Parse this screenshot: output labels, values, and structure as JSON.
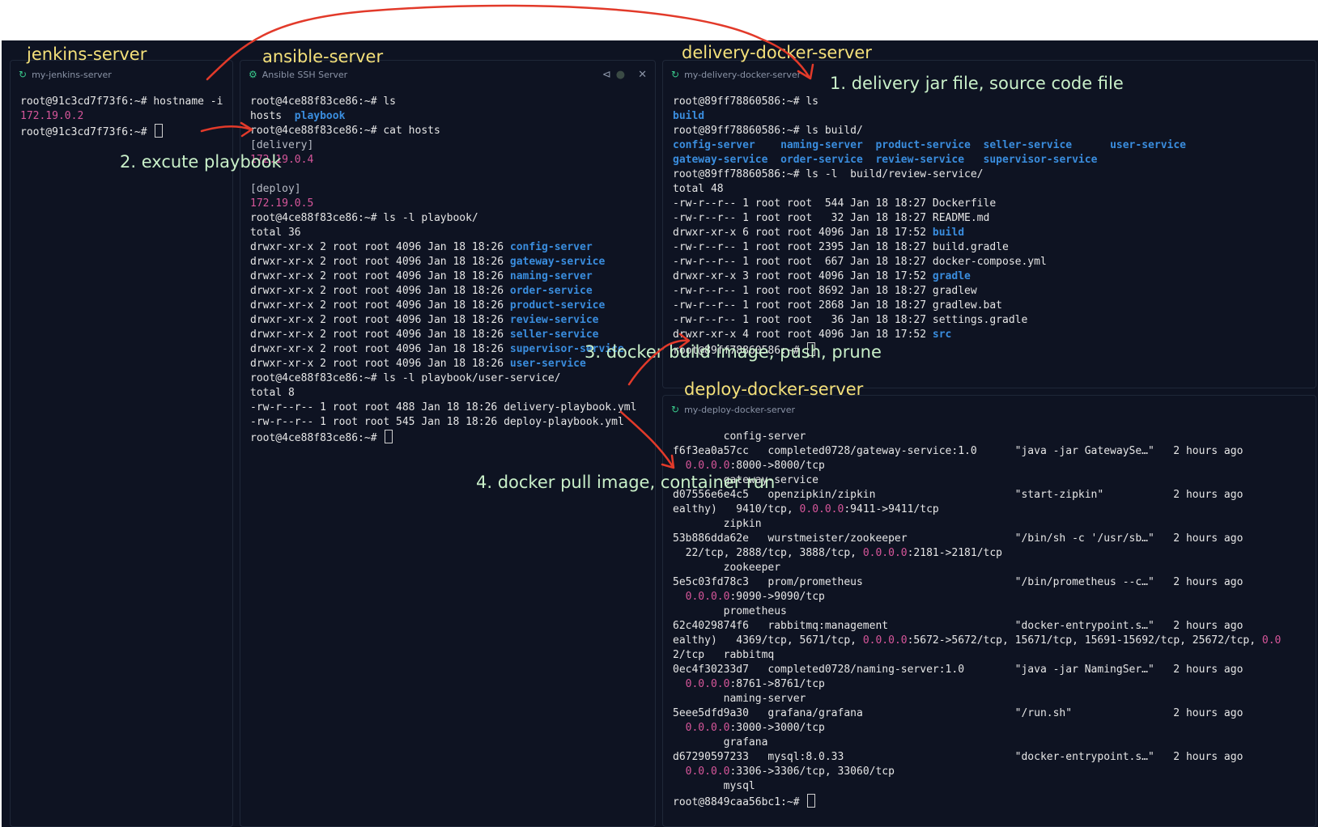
{
  "titles": {
    "jenkins": "jenkins-server",
    "ansible": "ansible-server",
    "delivery": "delivery-docker-server",
    "deploy": "deploy-docker-server"
  },
  "tabs": {
    "jenkins": "my-jenkins-server",
    "ansible": "Ansible SSH Server",
    "delivery": "my-delivery-docker-server",
    "deploy": "my-deploy-docker-server"
  },
  "icons": {
    "tab": "gear-icon",
    "split": "split-icon",
    "status": "status-dot-icon",
    "close": "close-icon"
  },
  "close_label": "✕",
  "notes": {
    "n1": "1.  delivery  jar file, source code file",
    "n2": "2.  excute playbook",
    "n3": "3.  docker build image, push, prune",
    "n4": "4.  docker pull image, container run"
  },
  "colors": {
    "background": "#0e1322",
    "title": "#f4e07a",
    "note": "#c9f0c9",
    "arrow": "#e23a2a",
    "ip": "#d6569a",
    "dir": "#3a8dde"
  },
  "jenkins_lines": [
    [
      {
        "t": "root@91c3cd7f73f6:~# hostname -i"
      }
    ],
    [
      {
        "t": "172.19.0.2",
        "c": "pink"
      }
    ],
    [
      {
        "t": "root@91c3cd7f73f6:~# "
      },
      {
        "cursor": true
      }
    ]
  ],
  "ansible_lines": [
    [
      {
        "t": "root@4ce88f83ce86:~# ls"
      }
    ],
    [
      {
        "t": "hosts  "
      },
      {
        "t": "playbook",
        "c": "blue"
      }
    ],
    [
      {
        "t": "root@4ce88f83ce86:~# cat hosts"
      }
    ],
    [
      {
        "t": "[delivery]",
        "c": "gray"
      }
    ],
    [
      {
        "t": "172.19.0.4",
        "c": "pink"
      }
    ],
    [
      {
        "t": ""
      }
    ],
    [
      {
        "t": "[deploy]",
        "c": "gray"
      }
    ],
    [
      {
        "t": "172.19.0.5",
        "c": "pink"
      }
    ],
    [
      {
        "t": "root@4ce88f83ce86:~# ls -l playbook/"
      }
    ],
    [
      {
        "t": "total 36"
      }
    ],
    [
      {
        "t": "drwxr-xr-x 2 root root 4096 Jan 18 18:26 "
      },
      {
        "t": "config-server",
        "c": "blue"
      }
    ],
    [
      {
        "t": "drwxr-xr-x 2 root root 4096 Jan 18 18:26 "
      },
      {
        "t": "gateway-service",
        "c": "blue"
      }
    ],
    [
      {
        "t": "drwxr-xr-x 2 root root 4096 Jan 18 18:26 "
      },
      {
        "t": "naming-server",
        "c": "blue"
      }
    ],
    [
      {
        "t": "drwxr-xr-x 2 root root 4096 Jan 18 18:26 "
      },
      {
        "t": "order-service",
        "c": "blue"
      }
    ],
    [
      {
        "t": "drwxr-xr-x 2 root root 4096 Jan 18 18:26 "
      },
      {
        "t": "product-service",
        "c": "blue"
      }
    ],
    [
      {
        "t": "drwxr-xr-x 2 root root 4096 Jan 18 18:26 "
      },
      {
        "t": "review-service",
        "c": "blue"
      }
    ],
    [
      {
        "t": "drwxr-xr-x 2 root root 4096 Jan 18 18:26 "
      },
      {
        "t": "seller-service",
        "c": "blue"
      }
    ],
    [
      {
        "t": "drwxr-xr-x 2 root root 4096 Jan 18 18:26 "
      },
      {
        "t": "supervisor-service",
        "c": "blue"
      }
    ],
    [
      {
        "t": "drwxr-xr-x 2 root root 4096 Jan 18 18:26 "
      },
      {
        "t": "user-service",
        "c": "blue"
      }
    ],
    [
      {
        "t": "root@4ce88f83ce86:~# ls -l playbook/user-service/"
      }
    ],
    [
      {
        "t": "total 8"
      }
    ],
    [
      {
        "t": "-rw-r--r-- 1 root root 488 Jan 18 18:26 delivery-playbook.yml"
      }
    ],
    [
      {
        "t": "-rw-r--r-- 1 root root 545 Jan 18 18:26 deploy-playbook.yml"
      }
    ],
    [
      {
        "t": "root@4ce88f83ce86:~# "
      },
      {
        "cursor": true
      }
    ]
  ],
  "delivery_lines": [
    [
      {
        "t": "root@89ff78860586:~# ls"
      }
    ],
    [
      {
        "t": "build",
        "c": "blue"
      }
    ],
    [
      {
        "t": "root@89ff78860586:~# ls build/"
      }
    ],
    [
      {
        "t": "config-server",
        "c": "blue"
      },
      {
        "t": "    "
      },
      {
        "t": "naming-server",
        "c": "blue"
      },
      {
        "t": "  "
      },
      {
        "t": "product-service",
        "c": "blue"
      },
      {
        "t": "  "
      },
      {
        "t": "seller-service",
        "c": "blue"
      },
      {
        "t": "      "
      },
      {
        "t": "user-service",
        "c": "blue"
      }
    ],
    [
      {
        "t": "gateway-service",
        "c": "blue"
      },
      {
        "t": "  "
      },
      {
        "t": "order-service",
        "c": "blue"
      },
      {
        "t": "  "
      },
      {
        "t": "review-service",
        "c": "blue"
      },
      {
        "t": "   "
      },
      {
        "t": "supervisor-service",
        "c": "blue"
      }
    ],
    [
      {
        "t": "root@89ff78860586:~# ls -l  build/review-service/"
      }
    ],
    [
      {
        "t": "total 48"
      }
    ],
    [
      {
        "t": "-rw-r--r-- 1 root root  544 Jan 18 18:27 Dockerfile"
      }
    ],
    [
      {
        "t": "-rw-r--r-- 1 root root   32 Jan 18 18:27 README.md"
      }
    ],
    [
      {
        "t": "drwxr-xr-x 6 root root 4096 Jan 18 17:52 "
      },
      {
        "t": "build",
        "c": "blue"
      }
    ],
    [
      {
        "t": "-rw-r--r-- 1 root root 2395 Jan 18 18:27 build.gradle"
      }
    ],
    [
      {
        "t": "-rw-r--r-- 1 root root  667 Jan 18 18:27 docker-compose.yml"
      }
    ],
    [
      {
        "t": "drwxr-xr-x 3 root root 4096 Jan 18 17:52 "
      },
      {
        "t": "gradle",
        "c": "blue"
      }
    ],
    [
      {
        "t": "-rw-r--r-- 1 root root 8692 Jan 18 18:27 gradlew"
      }
    ],
    [
      {
        "t": "-rw-r--r-- 1 root root 2868 Jan 18 18:27 gradlew.bat"
      }
    ],
    [
      {
        "t": "-rw-r--r-- 1 root root   36 Jan 18 18:27 settings.gradle"
      }
    ],
    [
      {
        "t": "drwxr-xr-x 4 root root 4096 Jan 18 17:52 "
      },
      {
        "t": "src",
        "c": "blue"
      }
    ],
    [
      {
        "t": "root@89ff78860586:~# "
      },
      {
        "cursor": true
      }
    ]
  ],
  "deploy_lines": [
    [
      {
        "t": "        config-server"
      }
    ],
    [
      {
        "t": "f6f3ea0a57cc   completed0728/gateway-service:1.0      \"java -jar GatewaySe…\"   2 hours ago"
      }
    ],
    [
      {
        "t": "  "
      },
      {
        "t": "0.0.0.0",
        "c": "pink"
      },
      {
        "t": ":8000->8000/tcp"
      }
    ],
    [
      {
        "t": "        gateway-service"
      }
    ],
    [
      {
        "t": "d07556e6e4c5   openzipkin/zipkin                      \"start-zipkin\"           2 hours ago"
      }
    ],
    [
      {
        "t": "ealthy)   9410/tcp, "
      },
      {
        "t": "0.0.0.0",
        "c": "pink"
      },
      {
        "t": ":9411->9411/tcp"
      }
    ],
    [
      {
        "t": "        zipkin"
      }
    ],
    [
      {
        "t": "53b886dda62e   wurstmeister/zookeeper                 \"/bin/sh -c '/usr/sb…\"   2 hours ago"
      }
    ],
    [
      {
        "t": "  22/tcp, 2888/tcp, 3888/tcp, "
      },
      {
        "t": "0.0.0.0",
        "c": "pink"
      },
      {
        "t": ":2181->2181/tcp"
      }
    ],
    [
      {
        "t": "        zookeeper"
      }
    ],
    [
      {
        "t": "5e5c03fd78c3   prom/prometheus                        \"/bin/prometheus --c…\"   2 hours ago"
      }
    ],
    [
      {
        "t": "  "
      },
      {
        "t": "0.0.0.0",
        "c": "pink"
      },
      {
        "t": ":9090->9090/tcp"
      }
    ],
    [
      {
        "t": "        prometheus"
      }
    ],
    [
      {
        "t": "62c4029874f6   rabbitmq:management                    \"docker-entrypoint.s…\"   2 hours ago"
      }
    ],
    [
      {
        "t": "ealthy)   4369/tcp, 5671/tcp, "
      },
      {
        "t": "0.0.0.0",
        "c": "pink"
      },
      {
        "t": ":5672->5672/tcp, 15671/tcp, 15691-15692/tcp, 25672/tcp, "
      },
      {
        "t": "0.0",
        "c": "pink"
      }
    ],
    [
      {
        "t": "2/tcp   rabbitmq"
      }
    ],
    [
      {
        "t": "0ec4f30233d7   completed0728/naming-server:1.0        \"java -jar NamingSer…\"   2 hours ago"
      }
    ],
    [
      {
        "t": "  "
      },
      {
        "t": "0.0.0.0",
        "c": "pink"
      },
      {
        "t": ":8761->8761/tcp"
      }
    ],
    [
      {
        "t": "        naming-server"
      }
    ],
    [
      {
        "t": "5eee5dfd9a30   grafana/grafana                        \"/run.sh\"                2 hours ago"
      }
    ],
    [
      {
        "t": "  "
      },
      {
        "t": "0.0.0.0",
        "c": "pink"
      },
      {
        "t": ":3000->3000/tcp"
      }
    ],
    [
      {
        "t": "        grafana"
      }
    ],
    [
      {
        "t": "d67290597233   mysql:8.0.33                           \"docker-entrypoint.s…\"   2 hours ago"
      }
    ],
    [
      {
        "t": "  "
      },
      {
        "t": "0.0.0.0",
        "c": "pink"
      },
      {
        "t": ":3306->3306/tcp, 33060/tcp"
      }
    ],
    [
      {
        "t": "        mysql"
      }
    ],
    [
      {
        "t": "root@8849caa56bc1:~# "
      },
      {
        "cursor": true
      }
    ]
  ]
}
